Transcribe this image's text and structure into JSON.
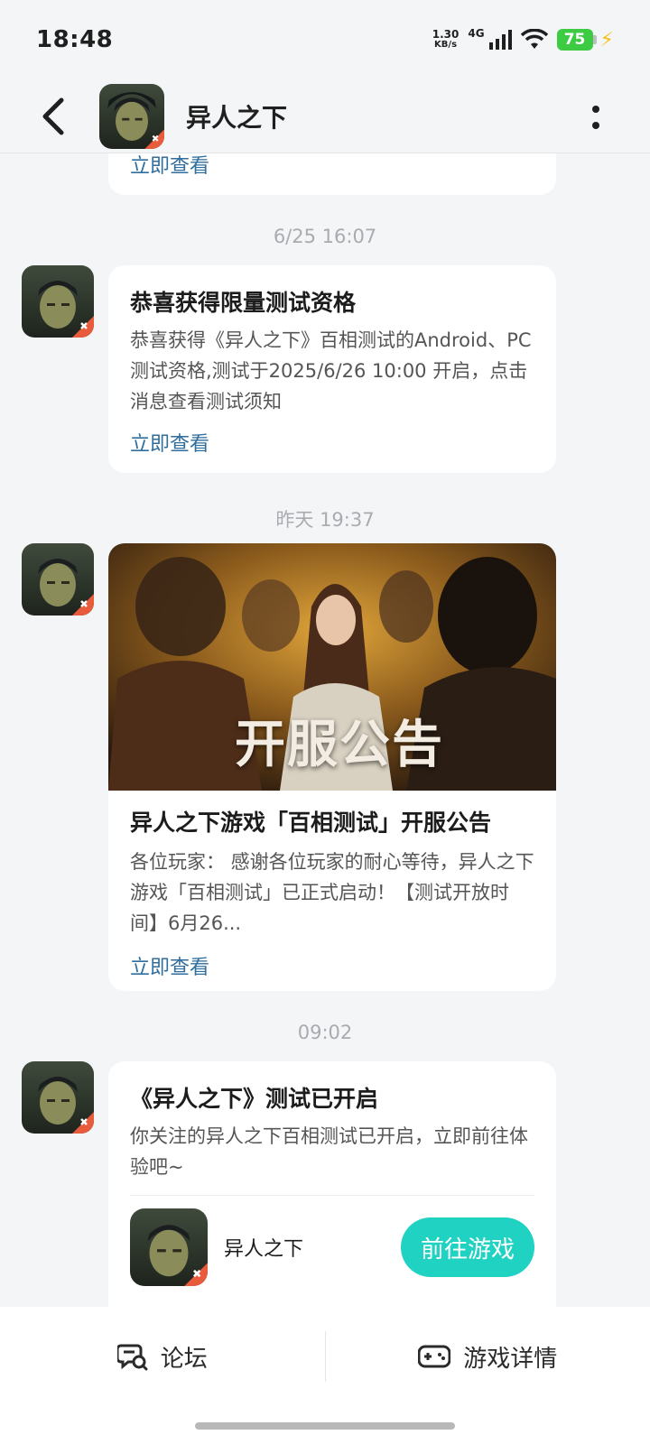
{
  "status_bar": {
    "time": "18:48",
    "net_speed_value": "1.30",
    "net_speed_unit": "KB/s",
    "network": "4G",
    "battery": "75"
  },
  "header": {
    "title": "异人之下"
  },
  "messages": [
    {
      "link": "立即查看"
    },
    {
      "time": "6/25  16:07",
      "title": "恭喜获得限量测试资格",
      "body": "恭喜获得《异人之下》百相测试的Android、PC测试资格,测试于2025/6/26 10:00 开启，点击消息查看测试须知",
      "link": "立即查看"
    },
    {
      "time": "昨天  19:37",
      "banner_text": "开服公告",
      "title": "异人之下游戏「百相测试」开服公告",
      "body": "各位玩家： 感谢各位玩家的耐心等待，异人之下游戏「百相测试」已正式启动！【测试开放时间】6月26...",
      "link": "立即查看"
    },
    {
      "time": "09:02",
      "title": "《异人之下》测试已开启",
      "body": "你关注的异人之下百相测试已开启，立即前往体验吧~",
      "game_name": "异人之下",
      "button": "前往游戏"
    }
  ],
  "bottom_bar": {
    "forum": "论坛",
    "game_details": "游戏详情"
  },
  "colors": {
    "link": "#2f6e9e",
    "accent_button": "#1fd2c1",
    "battery": "#3ecb44",
    "time_label": "#a9abb0"
  }
}
